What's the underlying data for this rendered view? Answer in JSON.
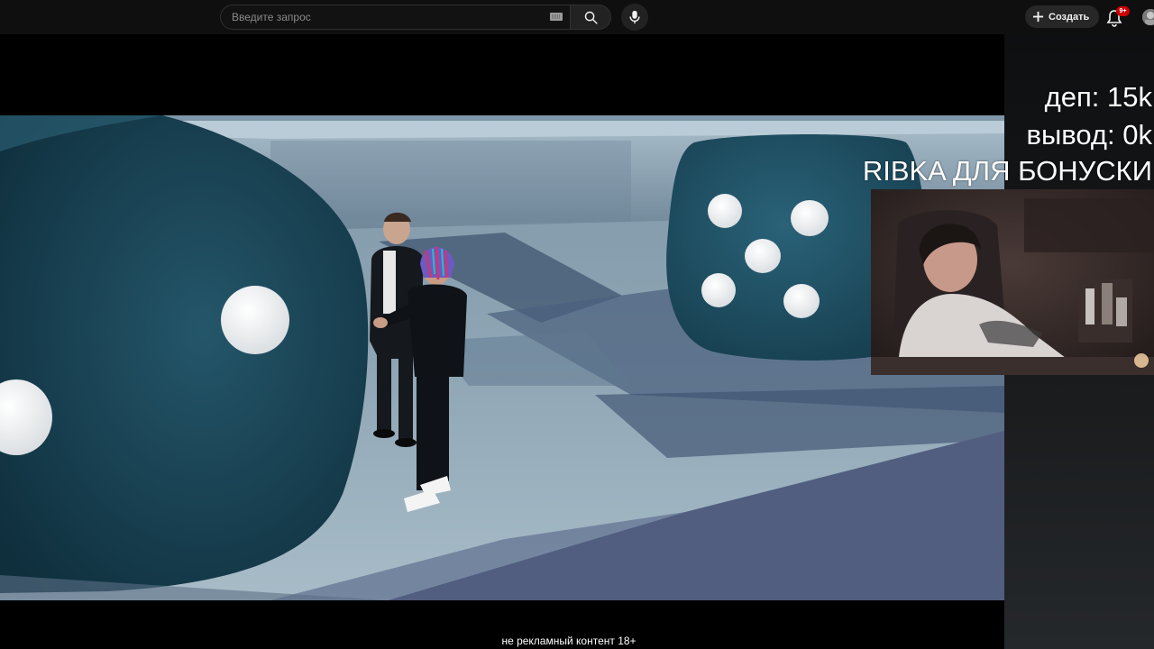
{
  "header": {
    "search": {
      "placeholder": "Введите запрос",
      "value": ""
    },
    "create_label": "Создать",
    "notifications_badge": "9+",
    "icons": [
      "keyboard-icon",
      "search-icon",
      "mic-icon",
      "plus-icon",
      "bell-icon"
    ]
  },
  "stream_overlay": {
    "deposit": "деп: 15k",
    "withdrawal": "вывод: 0k",
    "promo": "RIBKA ДЛЯ БОНУСКИ"
  },
  "video": {
    "disclaimer": "не рекламный контент 18+"
  },
  "colors": {
    "background": "#0f0f0f",
    "badge": "#cc0000",
    "dice": "#1e4a5c",
    "floor": "#8fa6b6"
  }
}
